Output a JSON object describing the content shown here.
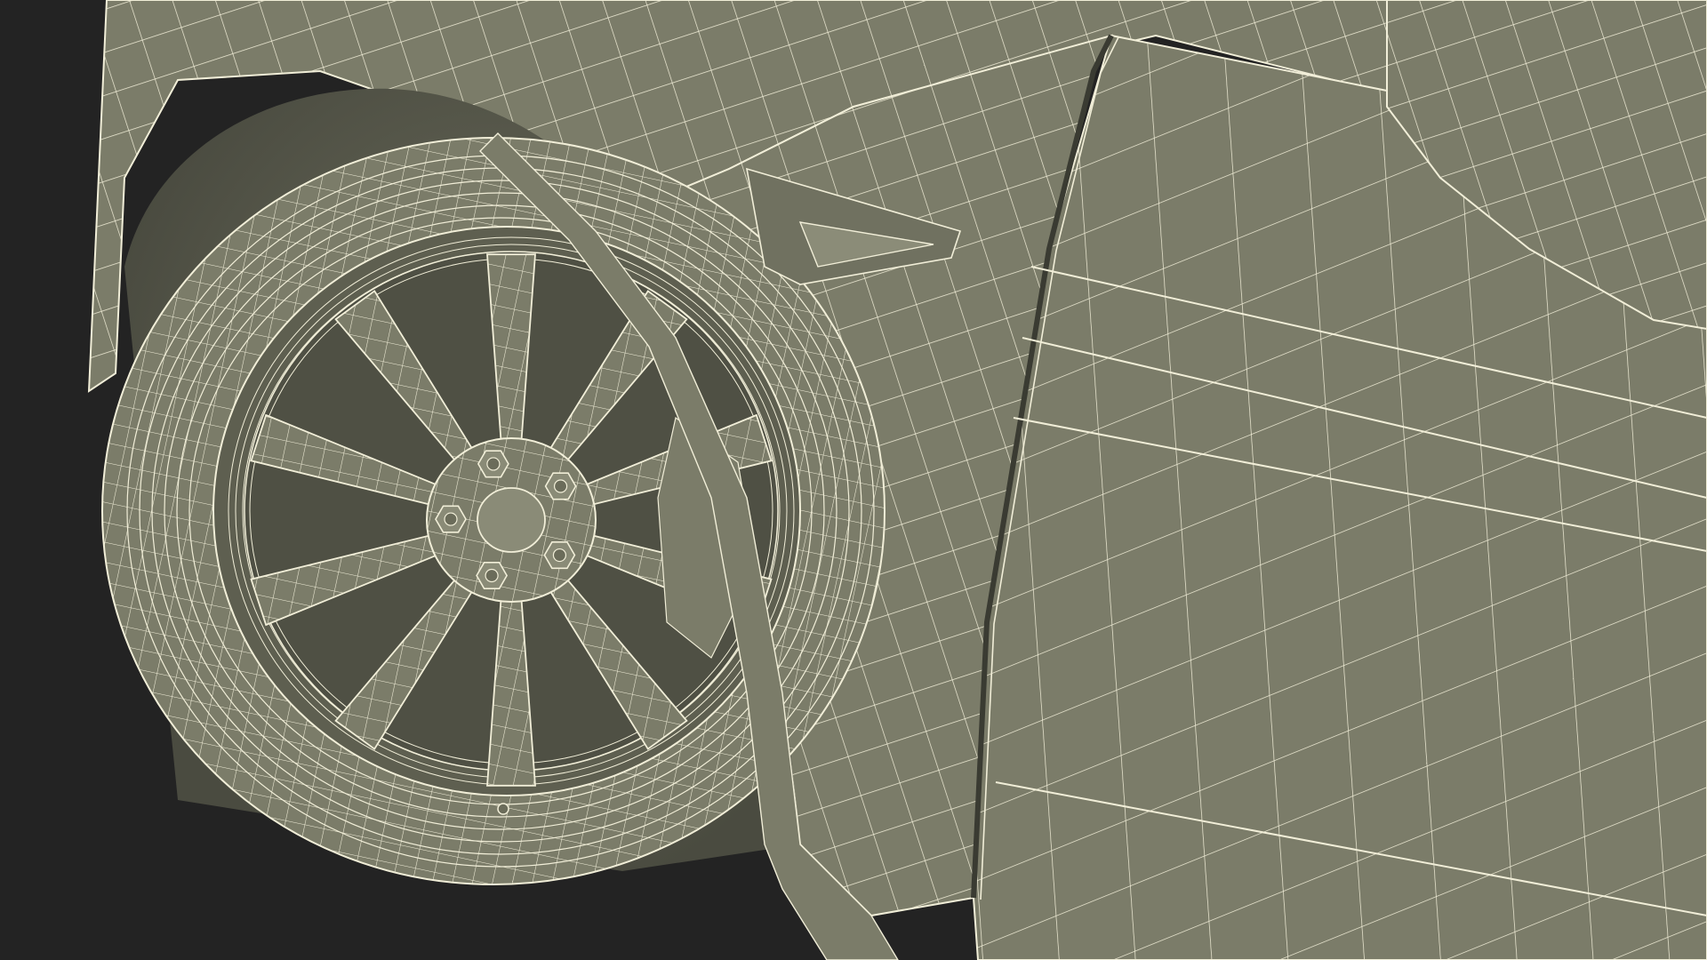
{
  "scene": {
    "subject": "car-front-wheel-wireframe",
    "render_style": "wireframe-on-shaded",
    "colors": {
      "background": "#232323",
      "surface": "#7b7c69",
      "surface_dark": "#5e5f50",
      "surface_shadow": "#4f5044",
      "wire": "#f1eed8"
    },
    "wheel": {
      "spokes": 10,
      "lug_nuts": 5
    }
  }
}
